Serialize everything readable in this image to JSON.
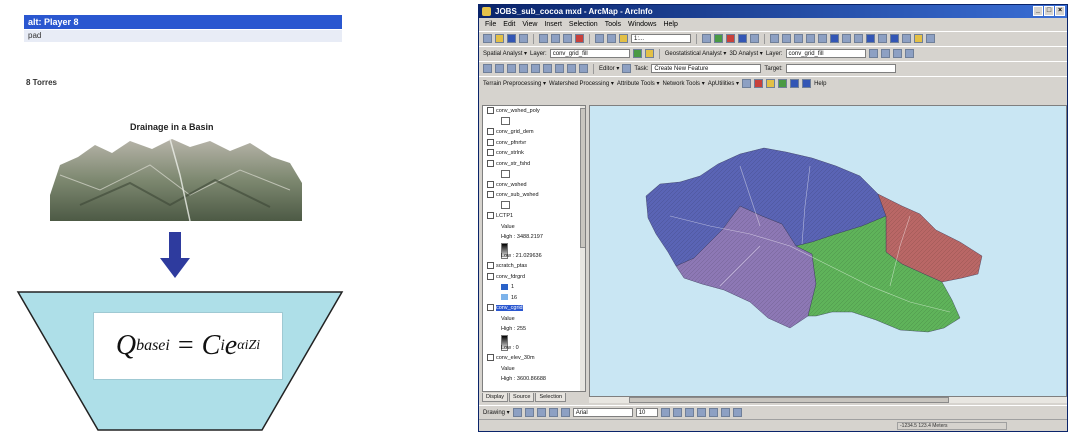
{
  "left_panel": {
    "layer_bar": "alt: Player  8",
    "layer_sub": "pad",
    "units": "8 Torres",
    "basin_title": "Drainage in a Basin",
    "formula": {
      "lhs": "Q",
      "lhs_sub": "basei",
      "equals": "=",
      "coef": "C",
      "coef_sub": "i",
      "exp_base": "e",
      "exponent": "αiZi"
    }
  },
  "window": {
    "title": "JOBS_sub_cocoa mxd - ArcMap - ArcInfo",
    "controls": [
      "_",
      "□",
      "×"
    ],
    "menu": [
      "File",
      "Edit",
      "View",
      "Insert",
      "Selection",
      "Tools",
      "Windows",
      "Help"
    ],
    "toolbar_1": {
      "combo": "1:..."
    },
    "toolbar_2": {
      "spatial_analyst_label": "Spatial Analyst ▾",
      "layer_label": "Layer:",
      "layer_value": "conv_grid_fill",
      "geostat_label": "Geostatistical Analyst ▾",
      "3d_label": "3D Analyst ▾",
      "layer_label_2": "Layer:",
      "layer_value_2": "conv_grid_fill"
    },
    "toolbar_3": {
      "editor_label": "Editor ▾",
      "task_label": "Task:",
      "task_value": "Create New Feature",
      "target_label": "Target:"
    },
    "toolbar_4": {
      "items": [
        "Terrain Preprocessing ▾",
        "Watershed Processing ▾",
        "Attribute Tools ▾",
        "Network Tools ▾",
        "ApUtilities ▾"
      ],
      "help_label": "Help"
    },
    "toc": {
      "items": [
        {
          "label": "conv_wshed_poly",
          "type": "layer"
        },
        {
          "label": "",
          "type": "swatch-empty"
        },
        {
          "label": "conv_grid_dem",
          "type": "layer"
        },
        {
          "label": "conv_pfnrtvr",
          "type": "layer"
        },
        {
          "label": "conv_strlnk",
          "type": "layer"
        },
        {
          "label": "conv_str_fshd",
          "type": "layer"
        },
        {
          "label": "",
          "type": "swatch-empty"
        },
        {
          "label": "conv_wshed",
          "type": "layer"
        },
        {
          "label": "conv_sub_wshed",
          "type": "layer"
        },
        {
          "label": "",
          "type": "swatch-empty"
        },
        {
          "label": "LCTP1",
          "type": "layer"
        },
        {
          "label": "Value",
          "type": "legend"
        },
        {
          "label": "High : 3488.2197",
          "type": "ramp-high"
        },
        {
          "label": "",
          "type": "ramp"
        },
        {
          "label": "Low : 21.029636",
          "type": "ramp-low"
        },
        {
          "label": "scratch_ptas",
          "type": "layer"
        },
        {
          "label": "conv_fdrgrd",
          "type": "layer"
        },
        {
          "label": "1",
          "type": "swatch-blue1"
        },
        {
          "label": "16",
          "type": "swatch-blue2"
        },
        {
          "label": "conv_cgrid",
          "type": "layer-selected"
        },
        {
          "label": "Value",
          "type": "legend"
        },
        {
          "label": "High : 255",
          "type": "ramp-high"
        },
        {
          "label": "",
          "type": "ramp"
        },
        {
          "label": "Low : 0",
          "type": "ramp-low"
        },
        {
          "label": "conv_elev_30m",
          "type": "layer"
        },
        {
          "label": "Value",
          "type": "legend"
        },
        {
          "label": "High : 3600.86688",
          "type": "ramp-high"
        }
      ],
      "tabs": [
        "Display",
        "Source",
        "Selection"
      ]
    },
    "map": {
      "background": "#c9e6f3",
      "subbasin_colors": {
        "north": "#5a64b5",
        "northeast": "#b96766",
        "west": "#8d78b5",
        "southeast": "#5fb35a"
      }
    },
    "drawing_bar": {
      "drawing_label": "Drawing ▾",
      "font_value": "Arial",
      "size_value": "10"
    },
    "status": {
      "text": "-1234.5  123.4 Meters"
    }
  }
}
